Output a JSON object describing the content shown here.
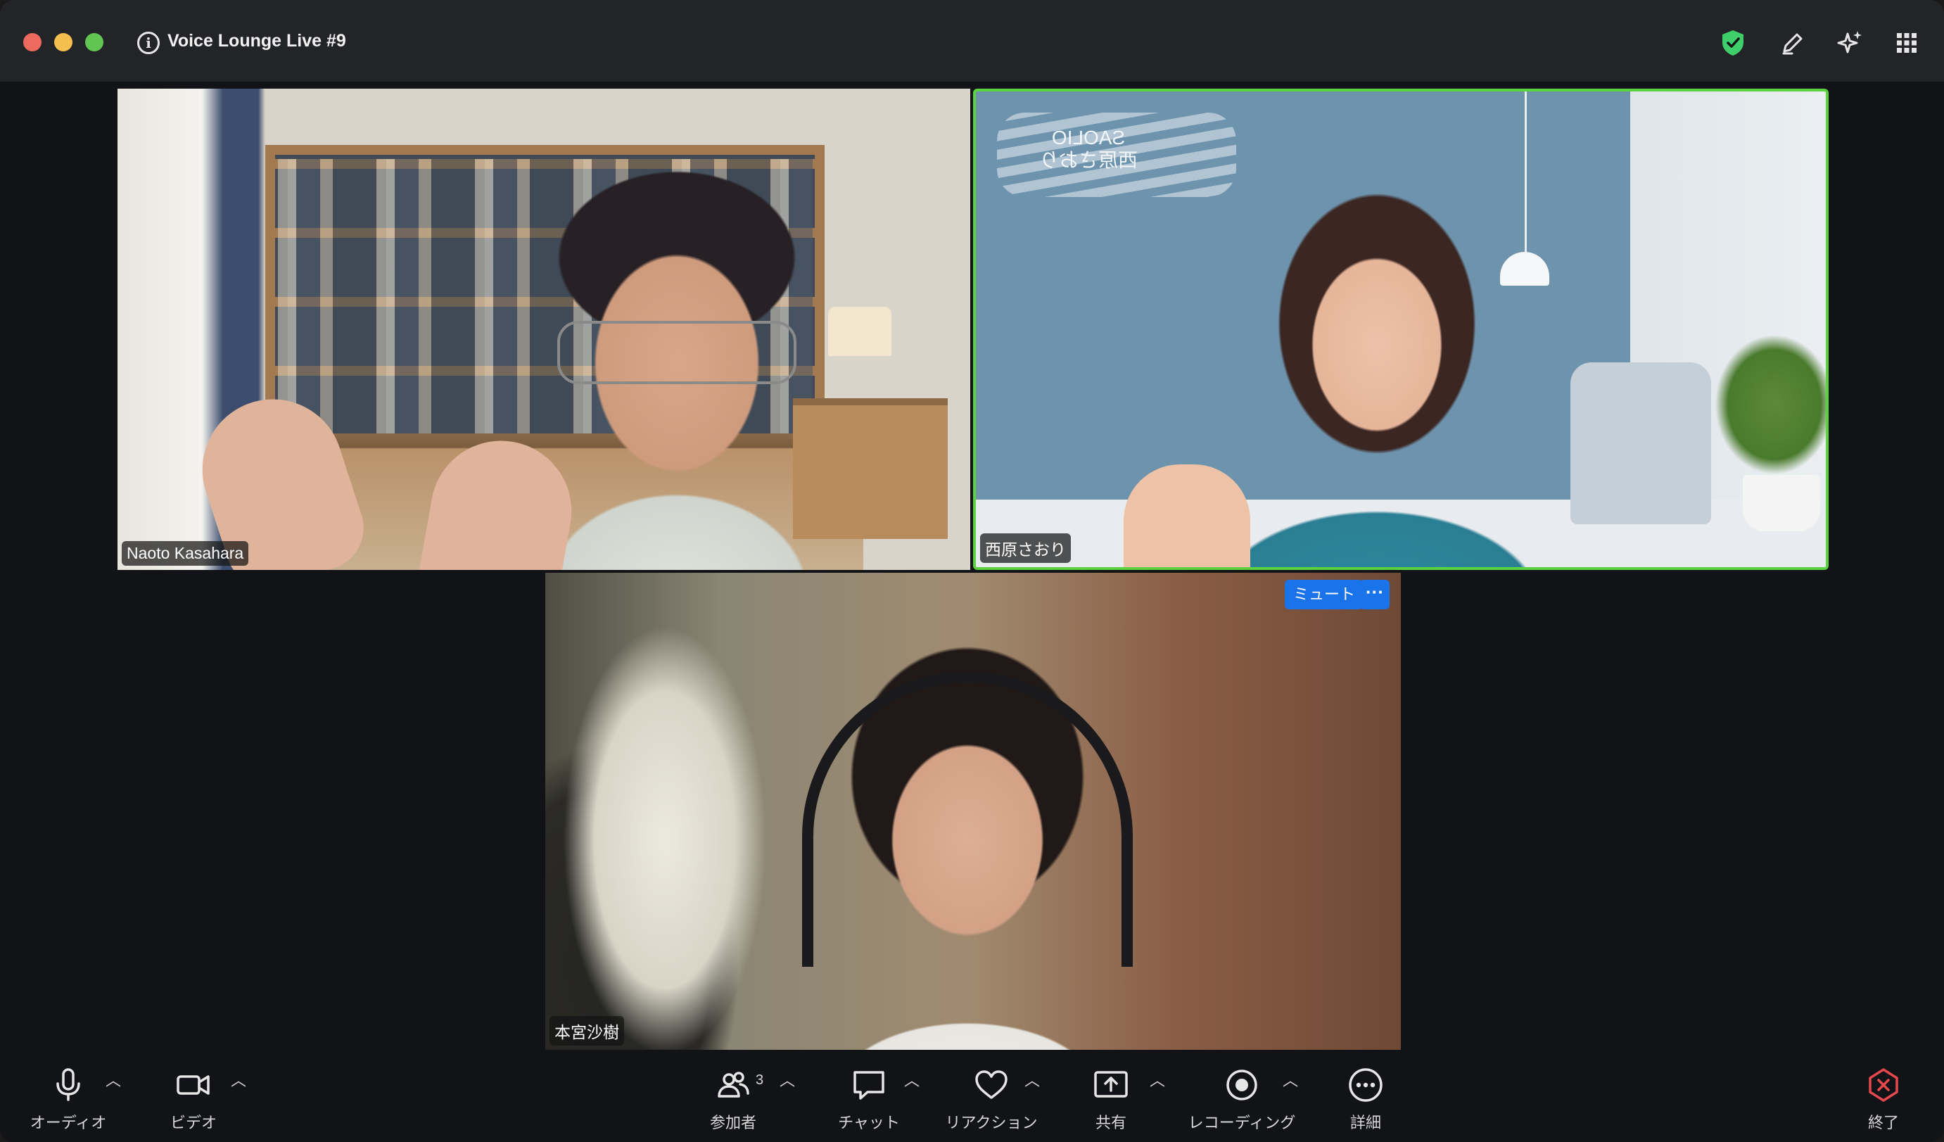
{
  "window": {
    "title": "Voice Lounge Live #9"
  },
  "participants": [
    {
      "name": "Naoto Kasahara",
      "active_speaker": false
    },
    {
      "name": "西原さおり",
      "active_speaker": true,
      "background_text": "SAOLIO\n西原さおり"
    },
    {
      "name": "本宮沙樹",
      "active_speaker": false
    }
  ],
  "tile_controls": {
    "mute_label": "ミュート",
    "more_label": "···"
  },
  "toolbar": {
    "audio": "オーディオ",
    "video": "ビデオ",
    "participants": "参加者",
    "participants_count": "3",
    "chat": "チャット",
    "reactions": "リアクション",
    "share": "共有",
    "recording": "レコーディング",
    "more": "詳細",
    "end": "終了"
  },
  "colors": {
    "accent_blue": "#1a73e8",
    "active_speaker_border": "#5bd33e",
    "security_green": "#3ecf6a",
    "end_red": "#e5484d"
  },
  "icons": [
    "info-icon",
    "security-shield-icon",
    "annotate-pencil-icon",
    "ai-sparkle-icon",
    "apps-grid-icon",
    "microphone-icon",
    "video-camera-icon",
    "participants-icon",
    "chat-bubble-icon",
    "heart-icon",
    "share-screen-icon",
    "record-icon",
    "more-icon",
    "end-meeting-icon"
  ]
}
